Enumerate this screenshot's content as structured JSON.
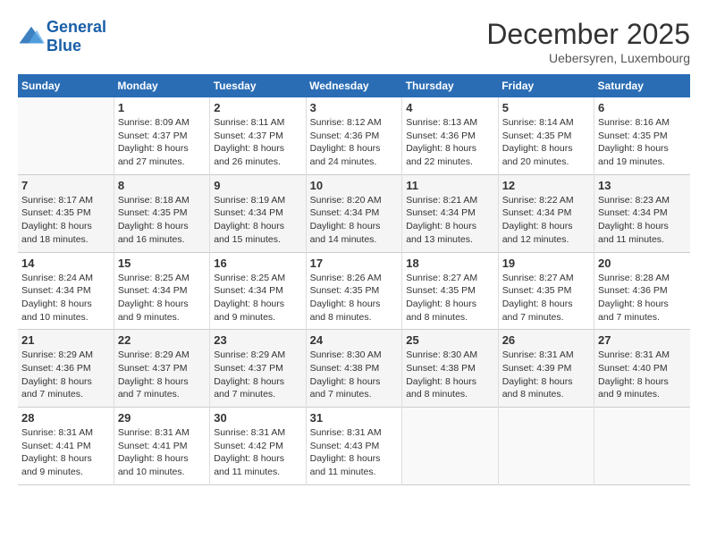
{
  "header": {
    "logo_line1": "General",
    "logo_line2": "Blue",
    "month_year": "December 2025",
    "location": "Uebersyren, Luxembourg"
  },
  "days_of_week": [
    "Sunday",
    "Monday",
    "Tuesday",
    "Wednesday",
    "Thursday",
    "Friday",
    "Saturday"
  ],
  "weeks": [
    [
      {
        "day": "",
        "sunrise": "",
        "sunset": "",
        "daylight": ""
      },
      {
        "day": "1",
        "sunrise": "Sunrise: 8:09 AM",
        "sunset": "Sunset: 4:37 PM",
        "daylight": "Daylight: 8 hours and 27 minutes."
      },
      {
        "day": "2",
        "sunrise": "Sunrise: 8:11 AM",
        "sunset": "Sunset: 4:37 PM",
        "daylight": "Daylight: 8 hours and 26 minutes."
      },
      {
        "day": "3",
        "sunrise": "Sunrise: 8:12 AM",
        "sunset": "Sunset: 4:36 PM",
        "daylight": "Daylight: 8 hours and 24 minutes."
      },
      {
        "day": "4",
        "sunrise": "Sunrise: 8:13 AM",
        "sunset": "Sunset: 4:36 PM",
        "daylight": "Daylight: 8 hours and 22 minutes."
      },
      {
        "day": "5",
        "sunrise": "Sunrise: 8:14 AM",
        "sunset": "Sunset: 4:35 PM",
        "daylight": "Daylight: 8 hours and 20 minutes."
      },
      {
        "day": "6",
        "sunrise": "Sunrise: 8:16 AM",
        "sunset": "Sunset: 4:35 PM",
        "daylight": "Daylight: 8 hours and 19 minutes."
      }
    ],
    [
      {
        "day": "7",
        "sunrise": "Sunrise: 8:17 AM",
        "sunset": "Sunset: 4:35 PM",
        "daylight": "Daylight: 8 hours and 18 minutes."
      },
      {
        "day": "8",
        "sunrise": "Sunrise: 8:18 AM",
        "sunset": "Sunset: 4:35 PM",
        "daylight": "Daylight: 8 hours and 16 minutes."
      },
      {
        "day": "9",
        "sunrise": "Sunrise: 8:19 AM",
        "sunset": "Sunset: 4:34 PM",
        "daylight": "Daylight: 8 hours and 15 minutes."
      },
      {
        "day": "10",
        "sunrise": "Sunrise: 8:20 AM",
        "sunset": "Sunset: 4:34 PM",
        "daylight": "Daylight: 8 hours and 14 minutes."
      },
      {
        "day": "11",
        "sunrise": "Sunrise: 8:21 AM",
        "sunset": "Sunset: 4:34 PM",
        "daylight": "Daylight: 8 hours and 13 minutes."
      },
      {
        "day": "12",
        "sunrise": "Sunrise: 8:22 AM",
        "sunset": "Sunset: 4:34 PM",
        "daylight": "Daylight: 8 hours and 12 minutes."
      },
      {
        "day": "13",
        "sunrise": "Sunrise: 8:23 AM",
        "sunset": "Sunset: 4:34 PM",
        "daylight": "Daylight: 8 hours and 11 minutes."
      }
    ],
    [
      {
        "day": "14",
        "sunrise": "Sunrise: 8:24 AM",
        "sunset": "Sunset: 4:34 PM",
        "daylight": "Daylight: 8 hours and 10 minutes."
      },
      {
        "day": "15",
        "sunrise": "Sunrise: 8:25 AM",
        "sunset": "Sunset: 4:34 PM",
        "daylight": "Daylight: 8 hours and 9 minutes."
      },
      {
        "day": "16",
        "sunrise": "Sunrise: 8:25 AM",
        "sunset": "Sunset: 4:34 PM",
        "daylight": "Daylight: 8 hours and 9 minutes."
      },
      {
        "day": "17",
        "sunrise": "Sunrise: 8:26 AM",
        "sunset": "Sunset: 4:35 PM",
        "daylight": "Daylight: 8 hours and 8 minutes."
      },
      {
        "day": "18",
        "sunrise": "Sunrise: 8:27 AM",
        "sunset": "Sunset: 4:35 PM",
        "daylight": "Daylight: 8 hours and 8 minutes."
      },
      {
        "day": "19",
        "sunrise": "Sunrise: 8:27 AM",
        "sunset": "Sunset: 4:35 PM",
        "daylight": "Daylight: 8 hours and 7 minutes."
      },
      {
        "day": "20",
        "sunrise": "Sunrise: 8:28 AM",
        "sunset": "Sunset: 4:36 PM",
        "daylight": "Daylight: 8 hours and 7 minutes."
      }
    ],
    [
      {
        "day": "21",
        "sunrise": "Sunrise: 8:29 AM",
        "sunset": "Sunset: 4:36 PM",
        "daylight": "Daylight: 8 hours and 7 minutes."
      },
      {
        "day": "22",
        "sunrise": "Sunrise: 8:29 AM",
        "sunset": "Sunset: 4:37 PM",
        "daylight": "Daylight: 8 hours and 7 minutes."
      },
      {
        "day": "23",
        "sunrise": "Sunrise: 8:29 AM",
        "sunset": "Sunset: 4:37 PM",
        "daylight": "Daylight: 8 hours and 7 minutes."
      },
      {
        "day": "24",
        "sunrise": "Sunrise: 8:30 AM",
        "sunset": "Sunset: 4:38 PM",
        "daylight": "Daylight: 8 hours and 7 minutes."
      },
      {
        "day": "25",
        "sunrise": "Sunrise: 8:30 AM",
        "sunset": "Sunset: 4:38 PM",
        "daylight": "Daylight: 8 hours and 8 minutes."
      },
      {
        "day": "26",
        "sunrise": "Sunrise: 8:31 AM",
        "sunset": "Sunset: 4:39 PM",
        "daylight": "Daylight: 8 hours and 8 minutes."
      },
      {
        "day": "27",
        "sunrise": "Sunrise: 8:31 AM",
        "sunset": "Sunset: 4:40 PM",
        "daylight": "Daylight: 8 hours and 9 minutes."
      }
    ],
    [
      {
        "day": "28",
        "sunrise": "Sunrise: 8:31 AM",
        "sunset": "Sunset: 4:41 PM",
        "daylight": "Daylight: 8 hours and 9 minutes."
      },
      {
        "day": "29",
        "sunrise": "Sunrise: 8:31 AM",
        "sunset": "Sunset: 4:41 PM",
        "daylight": "Daylight: 8 hours and 10 minutes."
      },
      {
        "day": "30",
        "sunrise": "Sunrise: 8:31 AM",
        "sunset": "Sunset: 4:42 PM",
        "daylight": "Daylight: 8 hours and 11 minutes."
      },
      {
        "day": "31",
        "sunrise": "Sunrise: 8:31 AM",
        "sunset": "Sunset: 4:43 PM",
        "daylight": "Daylight: 8 hours and 11 minutes."
      },
      {
        "day": "",
        "sunrise": "",
        "sunset": "",
        "daylight": ""
      },
      {
        "day": "",
        "sunrise": "",
        "sunset": "",
        "daylight": ""
      },
      {
        "day": "",
        "sunrise": "",
        "sunset": "",
        "daylight": ""
      }
    ]
  ]
}
